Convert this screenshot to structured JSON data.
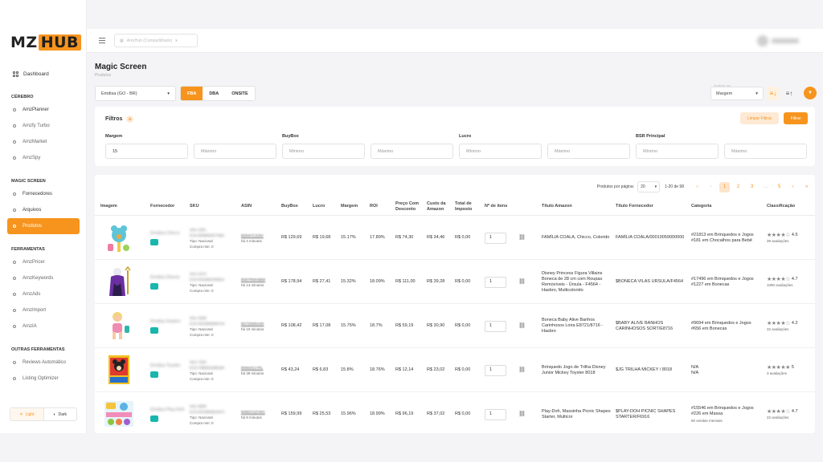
{
  "brand": {
    "logo_left": "MZ",
    "logo_hub": "HUB"
  },
  "sidebar": {
    "dashboard": "Dashboard",
    "sections": [
      {
        "title": "CÉREBRO",
        "items": [
          "AmzPlanner",
          "Amzfy Turbo",
          "AmzMarket",
          "AmzSpy"
        ]
      },
      {
        "title": "MAGIC SCREEN",
        "items": [
          "Fornecedores",
          "Arquivos",
          "Produtos"
        ]
      },
      {
        "title": "FERRAMENTAS",
        "items": [
          "AmzPricer",
          "AmzKeywords",
          "AmzAds",
          "AmzImport",
          "AmzIA"
        ]
      },
      {
        "title": "OUTRAS FERRAMENTAS",
        "items": [
          "Reviews Automático",
          "Listing Optimizer"
        ]
      }
    ],
    "active_item": "Produtos",
    "theme_light": "Light",
    "theme_dark": "Dark"
  },
  "topbar": {
    "store": "AmzHub (Compartilhado)"
  },
  "page": {
    "title": "Magic Screen",
    "subtitle": "Produtos"
  },
  "toolbar": {
    "marketplace": "Emdisa (GO - BR)",
    "modes": [
      "FBA",
      "DBA",
      "ONSITE"
    ],
    "active_mode": "FBA",
    "sort_label": "Ordenar por",
    "sort_value": "Margem"
  },
  "filters": {
    "title": "Filtros",
    "clear_label": "Limpar Filtros",
    "apply_label": "Filtrar",
    "groups": [
      {
        "label": "Margem",
        "min": "15",
        "max": "Máximo"
      },
      {
        "label": "BuyBox",
        "min": "Mínimo",
        "max": "Máximo"
      },
      {
        "label": "Lucro",
        "min": "Mínimo",
        "max": "Máximo"
      },
      {
        "label": "BSR Principal",
        "min": "Mínimo",
        "max": "Máximo"
      }
    ]
  },
  "pager": {
    "per_page_label": "Produtos por página:",
    "per_page": "20",
    "range": "1-20 de 98",
    "pages": [
      "1",
      "2",
      "3",
      "...",
      "5"
    ]
  },
  "table": {
    "headers": [
      "Imagem",
      "Fornecedor",
      "SKU",
      "ASIN",
      "BuyBox",
      "Lucro",
      "Margem",
      "ROI",
      "Preço Com Desconto",
      "Custo da Amazon",
      "Total de Imposto",
      "Nº de itens",
      "Título Amazon",
      "Título Fornecedor",
      "Categoria",
      "Classificação"
    ],
    "rows": [
      {
        "fornecedor": "Emdisa Chicco",
        "sku": "SKU 1001",
        "sku2": "EAN 8058664077662",
        "tipo": "Tipo: Nacional",
        "compra": "Compra min: 0",
        "asin": "B084HTJG9V",
        "asin_time": "há 4 minutos",
        "buybox": "R$ 129,69",
        "lucro": "R$ 19,68",
        "margem": "15.17%",
        "roi": "17.89%",
        "preco": "R$ 74,30",
        "custo": "R$ 34,46",
        "imposto": "R$ 0,00",
        "itens": "1",
        "titulo_amazon": "FAMÍLIA COALA, Chicco, Colorido",
        "titulo_fornecedor": "FAMÍLIA COALA/00010059000000",
        "cat1": "#21813 em Brinquedos e Jogos",
        "cat2": "#181 em Chocalhos para Bebê",
        "stars": "★★★★☆",
        "rating": "4.5",
        "reviews": "39 avaliações"
      },
      {
        "fornecedor": "Emdisa Disney",
        "sku": "SKU 4473",
        "sku2": "EAN 5010993780024",
        "tipo": "Tipo: Nacional",
        "compra": "Compra min: 0",
        "asin": "B087RMH6BM",
        "asin_time": "há 14 minutos",
        "buybox": "R$ 178,94",
        "lucro": "R$ 27,41",
        "margem": "15.32%",
        "roi": "18.09%",
        "preco": "R$ 111,00",
        "custo": "R$ 39,28",
        "imposto": "R$ 0,00",
        "itens": "1",
        "titulo_amazon": "Disney Princess Figura Villains Boneca de 28 cm com Roupas Removíveis - Úrsula - F4564 - Hasbro, Multicolorido",
        "titulo_fornecedor": "$BONECA VILAS URSULA/F4564",
        "cat1": "#17496 em Brinquedos e Jogos",
        "cat2": "#1227 em Bonecas",
        "stars": "★★★★☆",
        "rating": "4.7",
        "reviews": "1090 avaliações"
      },
      {
        "fornecedor": "Emdisa Hasbro",
        "sku": "SKU 3289",
        "sku2": "EAN 5010993848718",
        "tipo": "Tipo: Nacional",
        "compra": "Compra min: 0",
        "asin": "B07Z5MNV65",
        "asin_time": "há 10 minutos",
        "buybox": "R$ 108,42",
        "lucro": "R$ 17,08",
        "margem": "15.75%",
        "roi": "18.7%",
        "preco": "R$ 59,19",
        "custo": "R$ 30,90",
        "imposto": "R$ 0,00",
        "itens": "1",
        "titulo_amazon": "Boneca Baby Alive Banhos Carinhosos Loira E8721/8716 - Hasbro",
        "titulo_fornecedor": "$BABY ALIVE BANHOS CARINHOSOS SORT/E8716",
        "cat1": "#9694 em Brinquedos e Jogos",
        "cat2": "#656 em Bonecas",
        "stars": "★★★★☆",
        "rating": "4.2",
        "reviews": "32 avaliações"
      },
      {
        "fornecedor": "Emdisa Toyster",
        "sku": "SKU 7320",
        "sku2": "EAN 7896001980185",
        "tipo": "Tipo: Nacional",
        "compra": "Compra min: 0",
        "asin": "B0964S1YRL",
        "asin_time": "há 39 minutos",
        "buybox": "R$ 43,24",
        "lucro": "R$ 6,83",
        "margem": "15.8%",
        "roi": "18.76%",
        "preco": "R$ 12,14",
        "custo": "R$ 23,02",
        "imposto": "R$ 0,00",
        "itens": "1",
        "titulo_amazon": "Brinquedo Jogo de Trilha Disney Junior Mickey Toyster 8018",
        "titulo_fornecedor": "$JG TRILHA MICKEY / 8018",
        "cat1": "N/A",
        "cat2": "N/A",
        "stars": "★★★★★",
        "rating": "5",
        "reviews": "3 avaliações"
      },
      {
        "fornecedor": "Emdisa Play-Doh",
        "sku": "SKU 9908",
        "sku2": "EAN 5010993813073",
        "tipo": "Tipo: Nacional",
        "compra": "Compra min: 0",
        "asin": "B0BDC5ZVBG",
        "asin_time": "há 9 minutos",
        "buybox": "R$ 159,99",
        "lucro": "R$ 25,53",
        "margem": "15.96%",
        "roi": "18.99%",
        "preco": "R$ 96,19",
        "custo": "R$ 37,02",
        "imposto": "R$ 0,00",
        "itens": "1",
        "titulo_amazon": "Play-Doh, Massinha Picnic Shapes Starter, Multicor",
        "titulo_fornecedor": "$PLAY-DOH PICNIC SHAPES STARTER/F6916",
        "cat1": "#15546 em Brinquedos e Jogos",
        "cat2": "#226 em Massa",
        "cat3": "50 vendas mensais",
        "stars": "★★★★☆",
        "rating": "4.7",
        "reviews": "22 avaliações"
      }
    ]
  },
  "colors": {
    "accent": "#f7941d",
    "teal": "#19b6ad"
  }
}
